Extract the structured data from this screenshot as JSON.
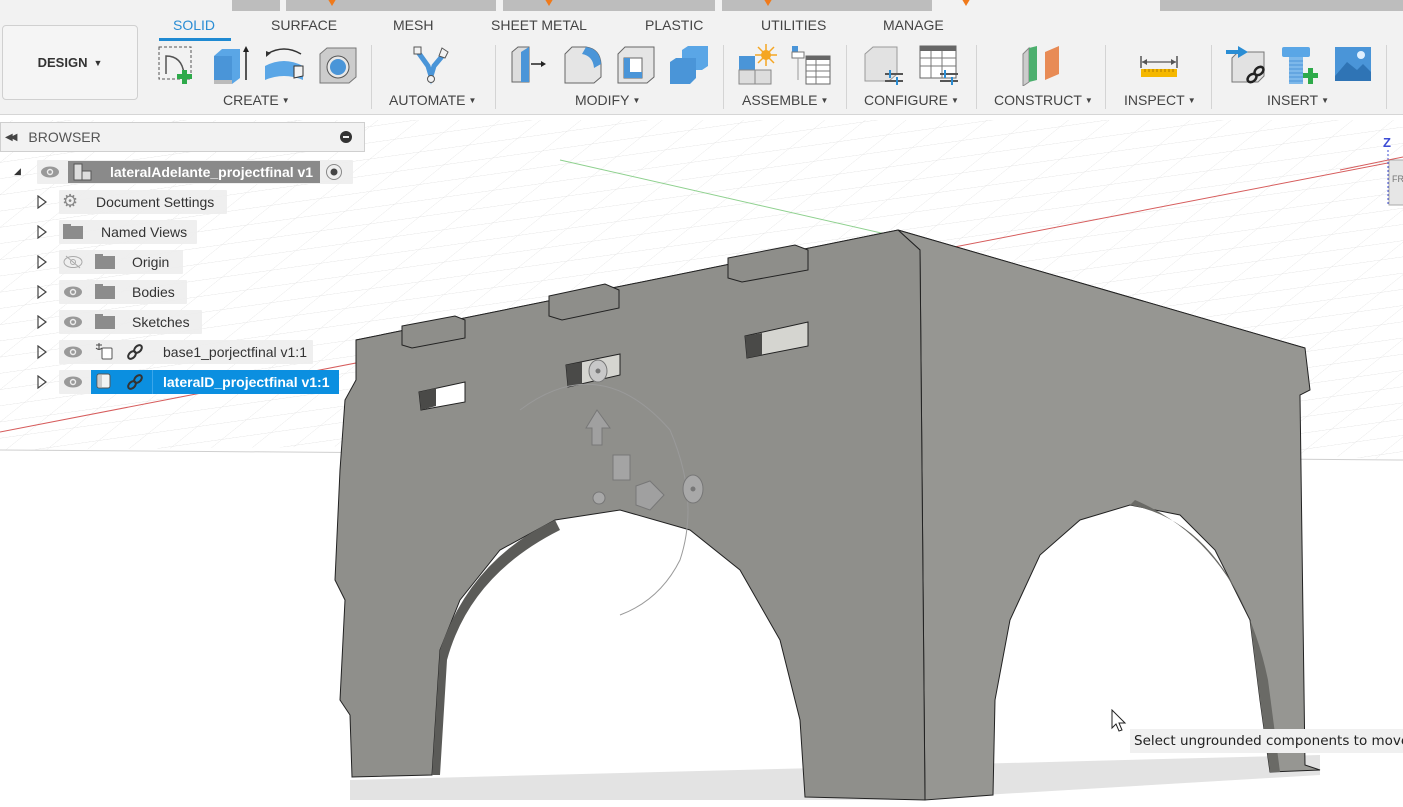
{
  "doc_tabs": [
    {
      "label": "",
      "active": false
    },
    {
      "label": "",
      "active": false
    },
    {
      "label": "",
      "active": false
    },
    {
      "label": "",
      "active": true
    }
  ],
  "toolbar": {
    "workspace_button": "DESIGN",
    "tabs": [
      {
        "label": "SOLID",
        "active": true
      },
      {
        "label": "SURFACE",
        "active": false
      },
      {
        "label": "MESH",
        "active": false
      },
      {
        "label": "SHEET METAL",
        "active": false
      },
      {
        "label": "PLASTIC",
        "active": false
      },
      {
        "label": "UTILITIES",
        "active": false
      },
      {
        "label": "MANAGE",
        "active": false
      }
    ],
    "groups": {
      "create": "CREATE",
      "automate": "AUTOMATE",
      "modify": "MODIFY",
      "assemble": "ASSEMBLE",
      "configure": "CONFIGURE",
      "construct": "CONSTRUCT",
      "inspect": "INSPECT",
      "insert": "INSERT"
    },
    "tools": {
      "create": [
        "create-sketch-icon",
        "extrude-icon",
        "revolve-icon",
        "hole-icon"
      ],
      "automate": [
        "automate-icon"
      ],
      "modify": [
        "press-pull-icon",
        "fillet-icon",
        "shell-icon",
        "combine-icon"
      ],
      "assemble": [
        "new-component-icon",
        "joint-table-icon"
      ],
      "configure": [
        "configure-model-icon",
        "configuration-table-icon"
      ],
      "construct": [
        "offset-plane-icon"
      ],
      "inspect": [
        "measure-icon"
      ],
      "insert": [
        "insert-derive-icon",
        "insert-fastener-icon",
        "insert-canvas-icon"
      ]
    }
  },
  "browser": {
    "title": "BROWSER",
    "root": "lateralAdelante_projectfinal v1",
    "items": [
      {
        "label": "Document Settings",
        "icon": "gear-icon",
        "visible": null
      },
      {
        "label": "Named Views",
        "icon": "folder-icon",
        "visible": null
      },
      {
        "label": "Origin",
        "icon": "folder-icon",
        "visible": false
      },
      {
        "label": "Bodies",
        "icon": "folder-icon",
        "visible": true
      },
      {
        "label": "Sketches",
        "icon": "folder-icon",
        "visible": true
      },
      {
        "label": "base1_porjectfinal v1:1",
        "icon": "component-grounded-icon",
        "visible": true,
        "linked": true
      },
      {
        "label": "lateralD_projectfinal v1:1",
        "icon": "component-icon",
        "visible": true,
        "linked": true,
        "selected": true
      }
    ]
  },
  "viewcube": {
    "axis_label": "Z",
    "face_label": "FR"
  },
  "tooltip": "Select ungrounded components to move",
  "colors": {
    "accent": "#1f8ad2",
    "selection": "#0b8fe0",
    "model": "#9a9a96",
    "x_axis": "#d23a3a",
    "y_axis": "#4caf50",
    "z_axis": "#3c4cd6"
  }
}
